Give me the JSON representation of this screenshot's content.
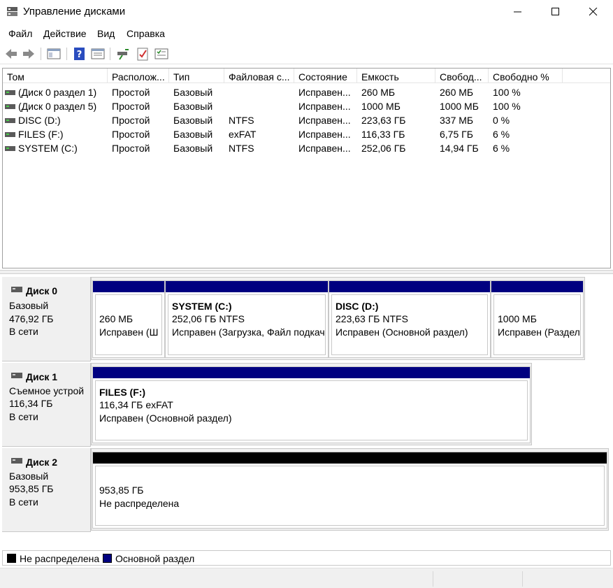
{
  "window": {
    "title": "Управление дисками",
    "icon": "disk-management-icon"
  },
  "menu": [
    "Файл",
    "Действие",
    "Вид",
    "Справка"
  ],
  "toolbar": {
    "icons": [
      "back-arrow-icon",
      "forward-arrow-icon",
      "console-tree-icon",
      "help-icon",
      "properties-icon",
      "connect-disk-icon",
      "check-icon",
      "list-view-icon"
    ]
  },
  "volume_list": {
    "columns": [
      "Том",
      "Располож...",
      "Тип",
      "Файловая с...",
      "Состояние",
      "Емкость",
      "Свобод...",
      "Свободно %"
    ],
    "rows": [
      [
        "(Диск 0 раздел 1)",
        "Простой",
        "Базовый",
        "",
        "Исправен...",
        "260 МБ",
        "260 МБ",
        "100 %"
      ],
      [
        "(Диск 0 раздел 5)",
        "Простой",
        "Базовый",
        "",
        "Исправен...",
        "1000 МБ",
        "1000 МБ",
        "100 %"
      ],
      [
        "DISC (D:)",
        "Простой",
        "Базовый",
        "NTFS",
        "Исправен...",
        "223,63 ГБ",
        "337 МБ",
        "0 %"
      ],
      [
        "FILES (F:)",
        "Простой",
        "Базовый",
        "exFAT",
        "Исправен...",
        "116,33 ГБ",
        "6,75 ГБ",
        "6 %"
      ],
      [
        "SYSTEM (C:)",
        "Простой",
        "Базовый",
        "NTFS",
        "Исправен...",
        "252,06 ГБ",
        "14,94 ГБ",
        "6 %"
      ]
    ]
  },
  "disks": [
    {
      "name": "Диск 0",
      "type": "Базовый",
      "size": "476,92 ГБ",
      "status": "В сети",
      "partitions": [
        {
          "title": "",
          "line1": "260 МБ",
          "line2": "Исправен (Ш"
        },
        {
          "title": "SYSTEM  (C:)",
          "line1": "252,06 ГБ NTFS",
          "line2": "Исправен (Загрузка, Файл подкач"
        },
        {
          "title": "DISC  (D:)",
          "line1": "223,63 ГБ NTFS",
          "line2": "Исправен (Основной раздел)"
        },
        {
          "title": "",
          "line1": "1000 МБ",
          "line2": "Исправен (Раздел"
        }
      ]
    },
    {
      "name": "Диск 1",
      "type": "Съемное устрой",
      "size": "116,34 ГБ",
      "status": "В сети",
      "partitions": [
        {
          "title": "FILES  (F:)",
          "line1": "116,34 ГБ exFAT",
          "line2": "Исправен (Основной раздел)"
        }
      ]
    },
    {
      "name": "Диск 2",
      "type": "Базовый",
      "size": "953,85 ГБ",
      "status": "В сети",
      "partitions": [
        {
          "title": "",
          "line1": "953,85 ГБ",
          "line2": "Не распределена"
        }
      ]
    }
  ],
  "legend": [
    {
      "label": "Не распределена",
      "color": "#000000"
    },
    {
      "label": "Основной раздел",
      "color": "#000080"
    }
  ],
  "colors": {
    "primary_partition": "#000080",
    "unallocated": "#000000"
  }
}
